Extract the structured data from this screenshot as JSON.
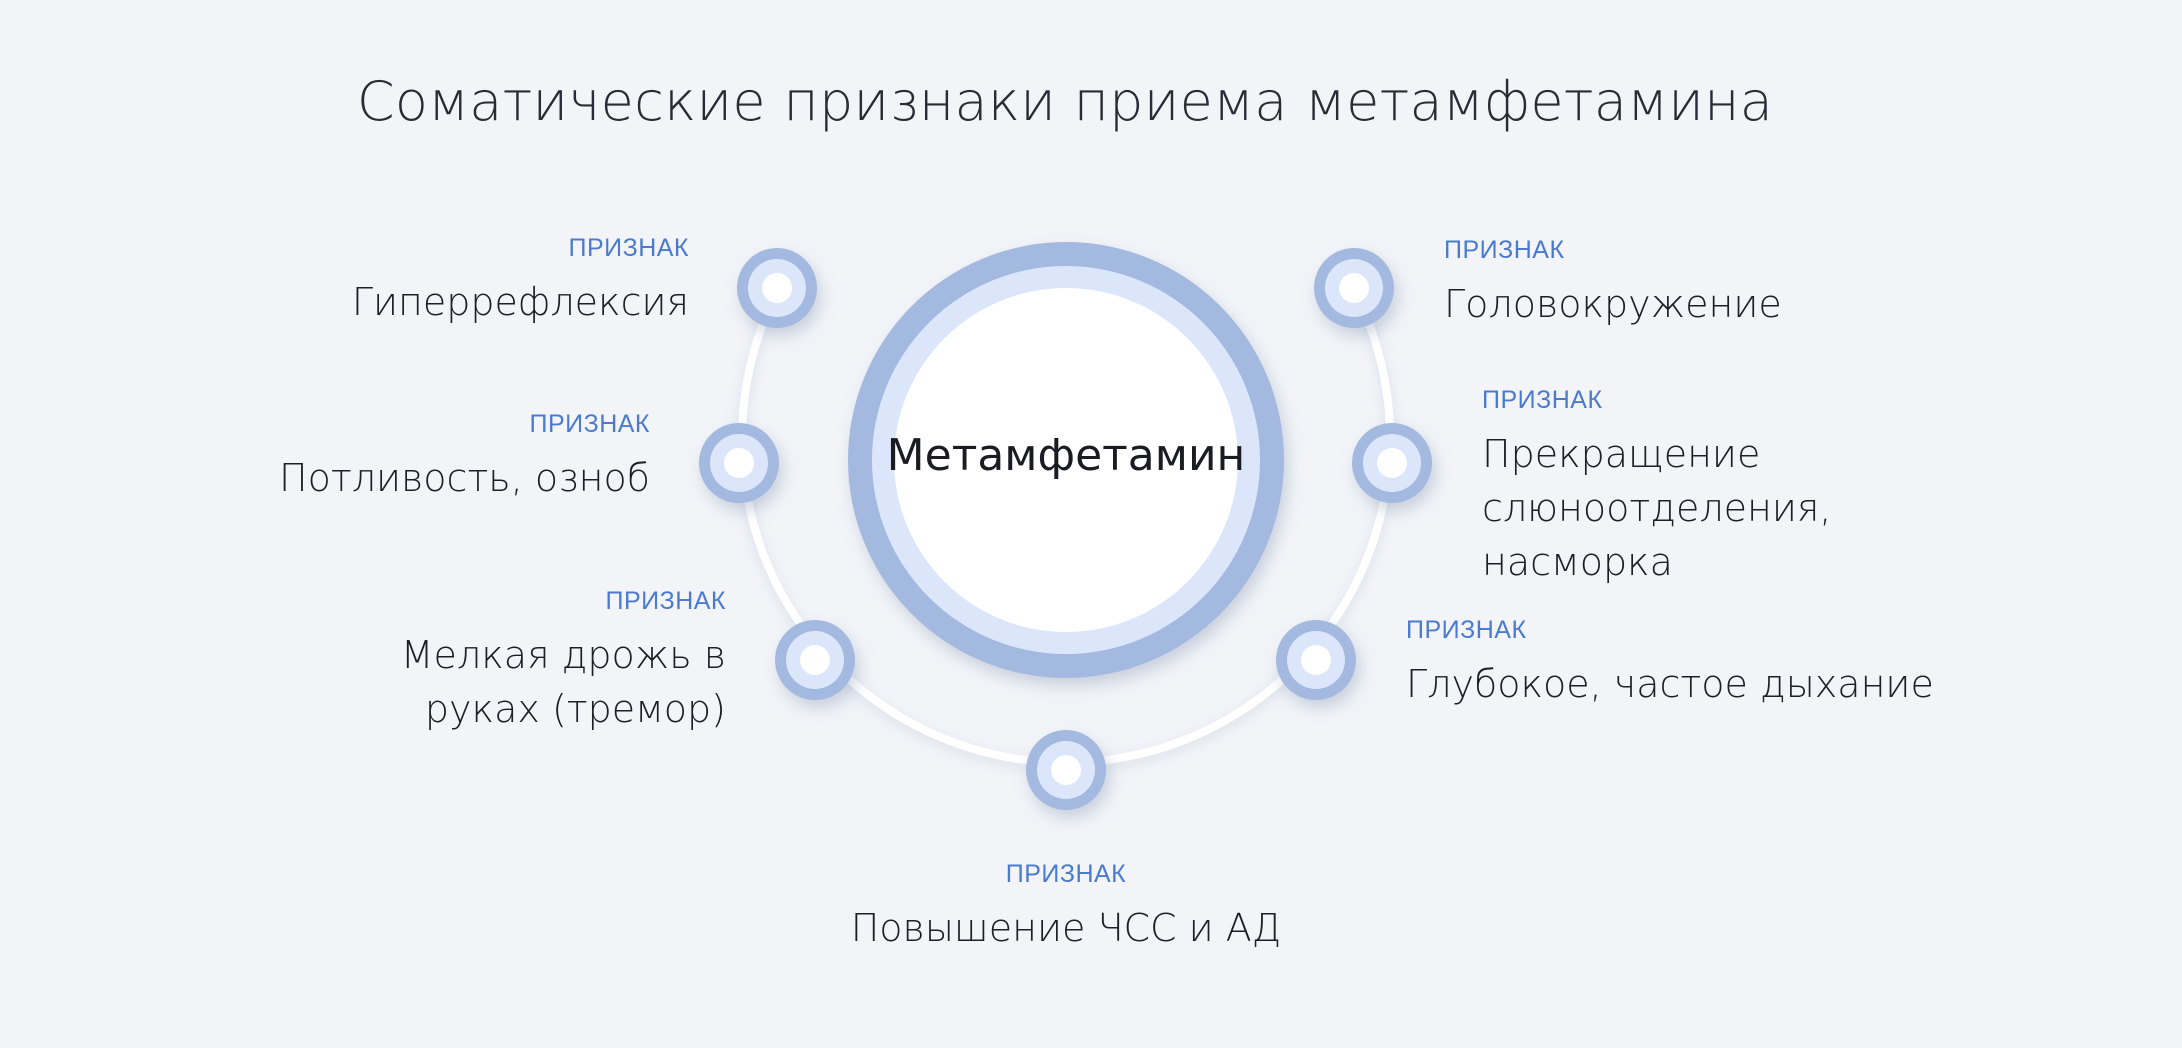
{
  "title": "Соматические признаки приема метамфетамина",
  "center": "Метамфетамин",
  "tag_text": "ПРИЗНАК",
  "items": [
    {
      "label": "Гиперрефлексия",
      "side": "left"
    },
    {
      "label": "Потливость, озноб",
      "side": "left"
    },
    {
      "label": "Мелкая дрожь в руках (тремор)",
      "side": "left"
    },
    {
      "label": "Повышение ЧСС и АД",
      "side": "bottom"
    },
    {
      "label": "Глубокое, частое дыхание",
      "side": "right"
    },
    {
      "label": "Прекращение слюноотделения, насморка",
      "side": "right"
    },
    {
      "label": "Головокружение",
      "side": "right"
    }
  ],
  "colors": {
    "accent": "#4a7bd0",
    "ring_outer": "#a4b9df",
    "ring_inner": "#dbe6fb",
    "arc": "#ffffff"
  }
}
